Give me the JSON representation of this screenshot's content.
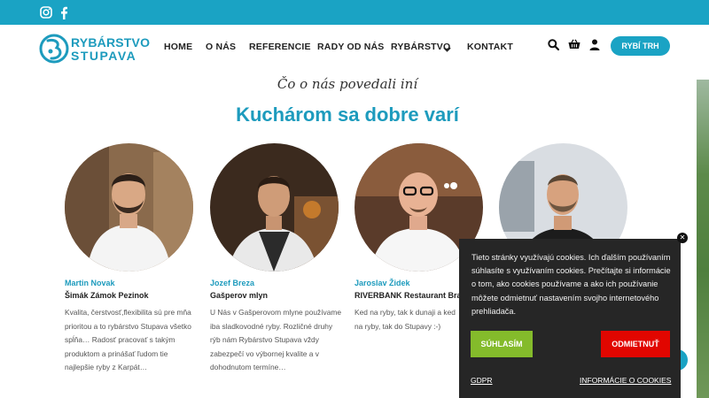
{
  "colors": {
    "brand": "#1aa3c4",
    "brand_text": "#1d9bbd",
    "accept": "#84bb2b",
    "reject": "#e10600",
    "cookie_bg": "#262626"
  },
  "header": {
    "social_icons": [
      "instagram-icon",
      "facebook-icon"
    ],
    "logo": {
      "line1": "RYBÁRSTVO",
      "line2": "STUPAVA"
    },
    "menu": [
      {
        "label": "HOME"
      },
      {
        "label": "O NÁS"
      },
      {
        "label": "REFERENCIE"
      },
      {
        "label": "RADY OD NÁS"
      },
      {
        "label": "RYBÁRSTVO"
      },
      {
        "label": "KONTAKT"
      }
    ],
    "action_icons": [
      "search-icon",
      "basket-icon",
      "user-icon"
    ],
    "cta_label": "RYBÍ TRH"
  },
  "section": {
    "subtitle": "Čo o nás povedali iní",
    "title": "Kuchárom sa dobre varí"
  },
  "testimonials": [
    {
      "name": "Martin Novak",
      "place": "Šimák Zámok Pezinok",
      "quote": "Kvalita, čerstvosť,flexibilita sú pre mňa prioritou a to rybárstvo Stupava všetko spĺňa… Radosť pracovať s takým produktom a prinášať ľudom tie najlepšie ryby z Karpát…"
    },
    {
      "name": "Jozef Breza",
      "place": "Gašperov mlyn",
      "quote": "U Nás v Gašperovom mlyne používame iba sladkovodné ryby. Rozličné druhy rýb nám Rybárstvo Stupava vždy zabezpečí vo výbornej kvalite a v dohodnutom termíne…"
    },
    {
      "name": "Jaroslav Židek",
      "place": "RIVERBANK Restaurant Bratis",
      "quote": "Ked na ryby, tak k dunaji a ked na ryby, tak do Stupavy :-)"
    },
    {
      "name": "",
      "place": "",
      "quote": ""
    }
  ],
  "cookie": {
    "text": "Tieto stránky využívajú cookies. Ich ďalším používaním súhlasíte s využívaním cookies. Prečítajte si informácie o tom, ako cookies používame a ako ich používanie môžete odmietnuť nastavením svojho internetového prehliadača.",
    "accept_label": "SÚHLASÍM",
    "reject_label": "ODMIETNUŤ",
    "gdpr_label": "GDPR",
    "info_label": "INFORMÁCIE O COOKIES"
  }
}
